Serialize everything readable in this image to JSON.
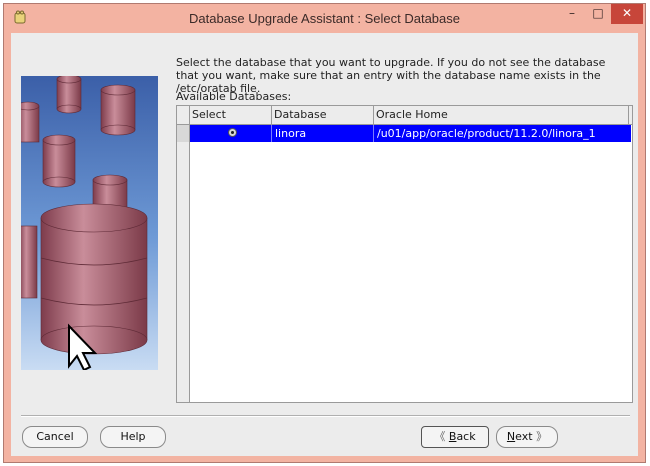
{
  "window": {
    "title": "Database Upgrade Assistant : Select Database",
    "min_label": "–",
    "max_label": "□",
    "close_label": "✕"
  },
  "content": {
    "instructions": "Select the database that you want to upgrade. If you do not see the database that you want, make sure that an entry with the database name exists in the /etc/oratab file.",
    "available_label": "Available Databases:"
  },
  "table": {
    "columns": [
      "Select",
      "Database",
      "Oracle Home"
    ],
    "rows": [
      {
        "selected": true,
        "database": "linora",
        "oracle_home": "/u01/app/oracle/product/11.2.0/linora_1"
      }
    ]
  },
  "buttons": {
    "cancel": "Cancel",
    "help": "Help",
    "back_prefix": "B",
    "back_rest": "ack",
    "next_prefix": "N",
    "next_rest": "ext",
    "back_chevron": "《",
    "next_chevron": "》"
  },
  "colors": {
    "titlebar": "#f3b3a2",
    "selection": "#0000ff",
    "close": "#c7463a"
  },
  "icons": {
    "app": "oracle-app-icon",
    "illustration": "database-cylinders-with-cursor"
  }
}
